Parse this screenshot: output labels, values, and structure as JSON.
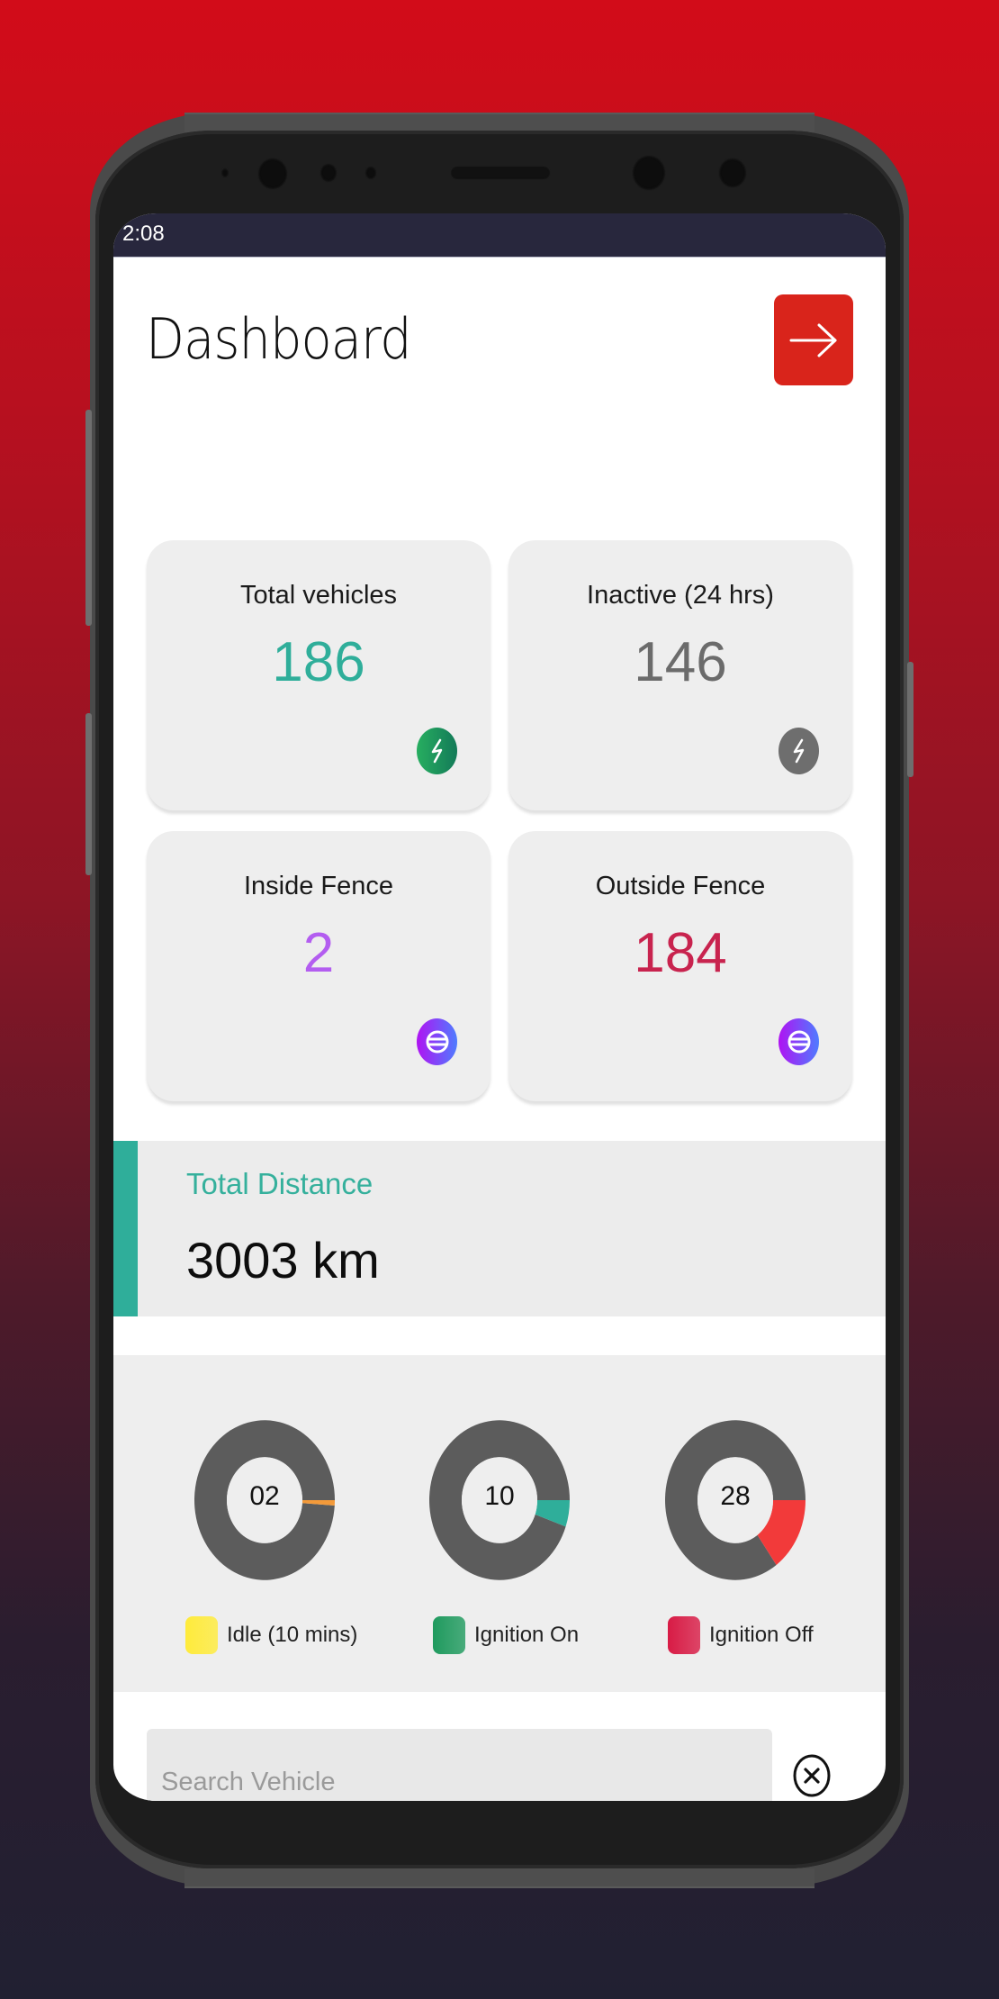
{
  "status_bar": {
    "time": "2:08"
  },
  "header": {
    "title": "Dashboard",
    "logout_icon": "arrow-right-icon"
  },
  "stats": [
    {
      "label": "Total vehicles",
      "value": "186",
      "value_color": "#2fae9a",
      "icon": "bolt-icon",
      "icon_bg": "#1f9a5e"
    },
    {
      "label": "Inactive (24 hrs)",
      "value": "146",
      "value_color": "#6b6b6b",
      "icon": "bolt-icon",
      "icon_bg": "#6e6e6e"
    },
    {
      "label": "Inside Fence",
      "value": "2",
      "value_color": "#b35df0",
      "icon": "globe-icon",
      "icon_bg": "#a020f0"
    },
    {
      "label": "Outside Fence",
      "value": "184",
      "value_color": "#c8234e",
      "icon": "globe-icon",
      "icon_bg": "#a020f0"
    }
  ],
  "distance": {
    "label": "Total Distance",
    "value": "3003 km",
    "accent": "#2fae9a"
  },
  "chart_data": {
    "type": "pie",
    "title": "",
    "total": 186,
    "series": [
      {
        "name": "Idle (10 mins)",
        "center_label": "02",
        "value": 2,
        "arc_color": "#f39a3a",
        "legend_color": "#ffeb3b"
      },
      {
        "name": "Ignition On",
        "center_label": "10",
        "value": 10,
        "arc_color": "#2fae9a",
        "legend_color": "#1f9a5e"
      },
      {
        "name": "Ignition Off",
        "center_label": "28",
        "value": 28,
        "arc_color": "#f23a3a",
        "legend_color": "#d81b45"
      }
    ],
    "remainder_color": "#5c5c5c"
  },
  "search": {
    "placeholder": "Search Vehicle",
    "value": "",
    "clear_icon": "close-circle-icon"
  }
}
